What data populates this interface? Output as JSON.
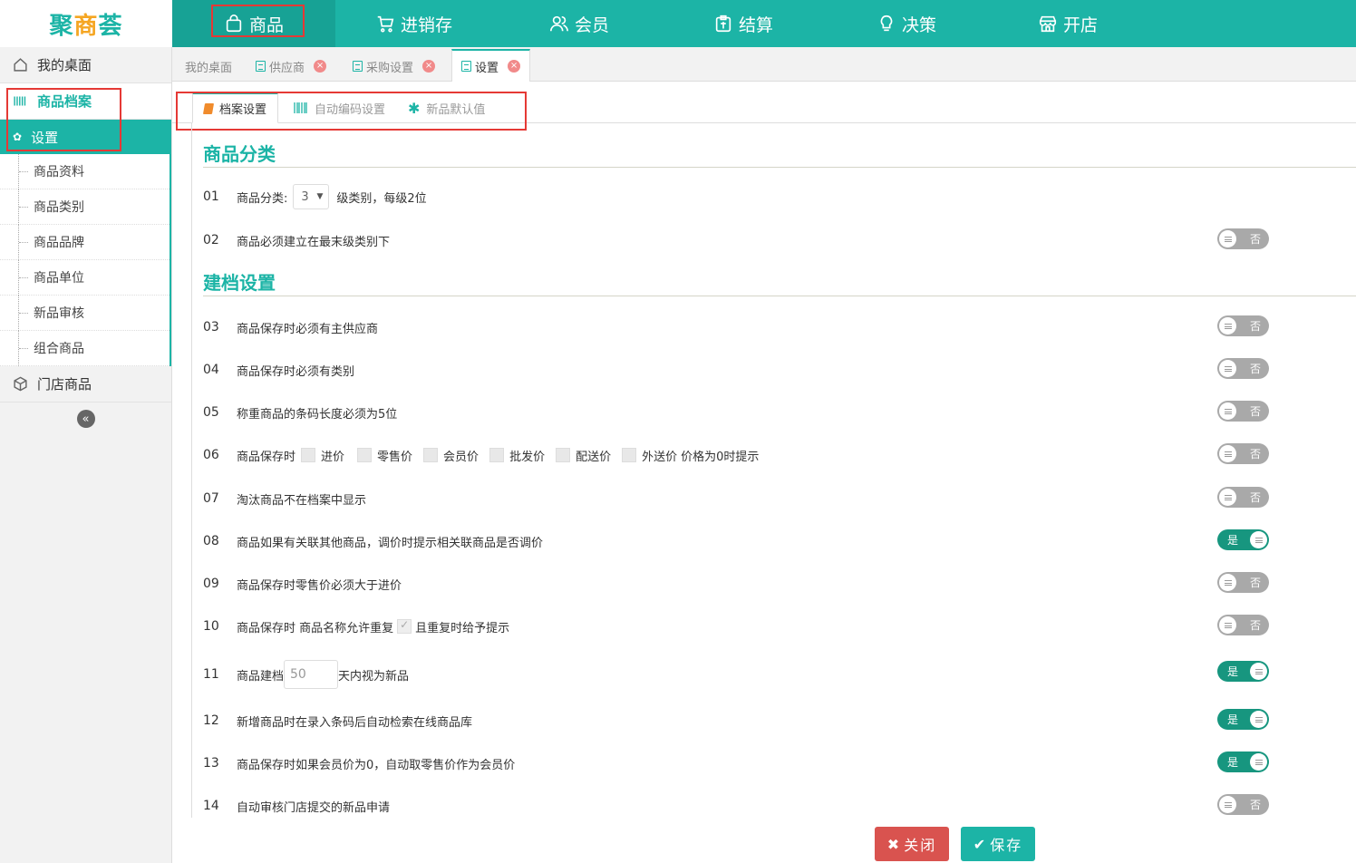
{
  "app": {
    "logo_part1": "聚",
    "logo_part2": "商",
    "logo_part3": "荟"
  },
  "topnav": [
    {
      "label": "商品",
      "icon": "bag-icon"
    },
    {
      "label": "进销存",
      "icon": "cart-icon"
    },
    {
      "label": "会员",
      "icon": "users-icon"
    },
    {
      "label": "结算",
      "icon": "wallet-icon"
    },
    {
      "label": "决策",
      "icon": "lightbulb-icon"
    },
    {
      "label": "开店",
      "icon": "store-icon"
    }
  ],
  "sidebar": {
    "desk": "我的桌面",
    "archive": "商品档案",
    "settings": "设置",
    "items": [
      "商品资料",
      "商品类别",
      "商品品牌",
      "商品单位",
      "新品审核",
      "组合商品"
    ],
    "store_goods": "门店商品"
  },
  "tabs": [
    {
      "label": "我的桌面"
    },
    {
      "label": "供应商"
    },
    {
      "label": "采购设置"
    },
    {
      "label": "设置"
    }
  ],
  "subtabs": [
    {
      "label": "档案设置"
    },
    {
      "label": "自动编码设置"
    },
    {
      "label": "新品默认值"
    }
  ],
  "sections": {
    "category": "商品分类",
    "archive": "建档设置"
  },
  "rows": {
    "r01": {
      "num": "01",
      "prefix": "商品分类:",
      "select_value": "3",
      "suffix": "级类别，每级2位"
    },
    "r02": {
      "num": "02",
      "text": "商品必须建立在最末级类别下",
      "toggle": "否"
    },
    "r03": {
      "num": "03",
      "text": "商品保存时必须有主供应商",
      "toggle": "否"
    },
    "r04": {
      "num": "04",
      "text": "商品保存时必须有类别",
      "toggle": "否"
    },
    "r05": {
      "num": "05",
      "text": "称重商品的条码长度必须为5位",
      "toggle": "否"
    },
    "r06": {
      "num": "06",
      "prefix": "商品保存时",
      "options": [
        "进价",
        "零售价",
        "会员价",
        "批发价",
        "配送价",
        "外送价"
      ],
      "suffix": "价格为0时提示",
      "toggle": "否"
    },
    "r07": {
      "num": "07",
      "text": "淘汰商品不在档案中显示",
      "toggle": "否"
    },
    "r08": {
      "num": "08",
      "text": "商品如果有关联其他商品，调价时提示相关联商品是否调价",
      "toggle": "是"
    },
    "r09": {
      "num": "09",
      "text": "商品保存时零售价必须大于进价",
      "toggle": "否"
    },
    "r10": {
      "num": "10",
      "prefix": "商品保存时 商品名称允许重复",
      "suffix": "且重复时给予提示",
      "toggle": "否"
    },
    "r11": {
      "num": "11",
      "prefix": "商品建档",
      "input_value": "50",
      "suffix": "天内视为新品",
      "toggle": "是"
    },
    "r12": {
      "num": "12",
      "text": "新增商品时在录入条码后自动检索在线商品库",
      "toggle": "是"
    },
    "r13": {
      "num": "13",
      "text": "商品保存时如果会员价为0，自动取零售价作为会员价",
      "toggle": "是"
    },
    "r14": {
      "num": "14",
      "text": "自动审核门店提交的新品申请",
      "toggle": "否"
    }
  },
  "buttons": {
    "close": "关闭",
    "save": "保存"
  },
  "colors": {
    "accent": "#1cb4a6",
    "toggle_on": "#17967f",
    "toggle_off": "#a9a9a9",
    "danger": "#d9534f",
    "highlight_box": "#e53935"
  }
}
